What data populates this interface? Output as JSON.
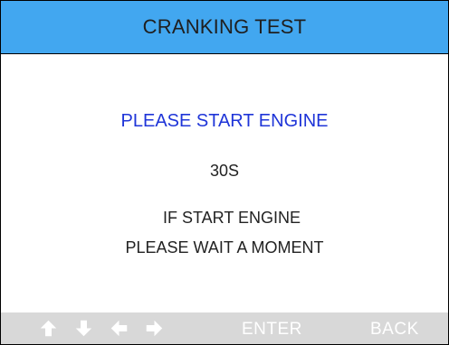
{
  "header": {
    "title": "CRANKING TEST"
  },
  "main": {
    "prompt": "PLEASE START ENGINE",
    "countdown": "30S",
    "info_line1": "IF START ENGINE",
    "info_line2": "PLEASE WAIT A MOMENT"
  },
  "footer": {
    "nav_icons": [
      "up-arrow-icon",
      "down-arrow-icon",
      "left-arrow-icon",
      "right-arrow-icon"
    ],
    "enter_label": "ENTER",
    "back_label": "BACK"
  },
  "colors": {
    "header_bg": "#42a7f0",
    "prompt_text": "#1f35d8",
    "footer_bg": "#d8d8d8",
    "icon_color": "#ffffff"
  }
}
